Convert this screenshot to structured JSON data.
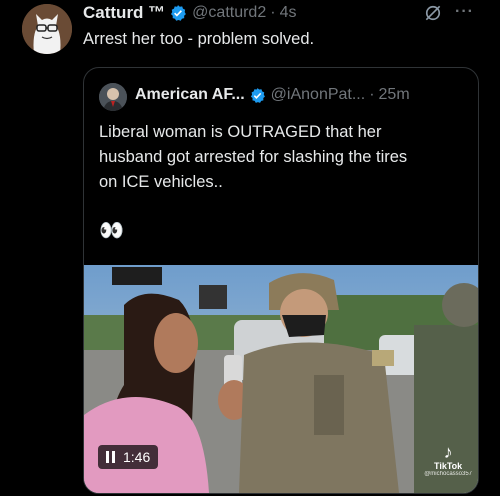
{
  "tweet": {
    "author_name": "Catturd ™",
    "handle": "@catturd2",
    "separator": "·",
    "time": "4s",
    "text": "Arrest her too - problem solved."
  },
  "quote": {
    "author_name": "American AF...",
    "handle": "@iAnonPat...",
    "separator": "·",
    "time": "25m",
    "text_lines": [
      "Liberal woman is OUTRAGED that her",
      "husband got arrested for slashing the tires",
      "on ICE vehicles.."
    ],
    "emoji": "👀",
    "video": {
      "duration": "1:46",
      "watermark_label": "TikTok",
      "watermark_user": "@michocasso357"
    }
  },
  "colors": {
    "background": "#000000",
    "text_primary": "#e7e9ea",
    "text_secondary": "#71767b",
    "verified": "#1d9bf0",
    "border": "#2f3336"
  },
  "icons": [
    "verified-badge-icon",
    "grok-icon",
    "more-icon",
    "pause-icon",
    "tiktok-icon"
  ]
}
